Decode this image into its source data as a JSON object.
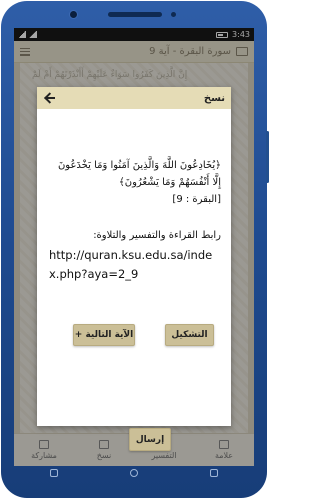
{
  "status_bar": {
    "clock": "3:43"
  },
  "app_bar": {
    "title": "سورة البقرة - آية 9"
  },
  "background_ayah": "إِنَّ الَّذِينَ كَفَرُوا سَوَاءٌ عَلَيْهِمْ أَأَنْذَرْتَهُمْ أَمْ لَمْ",
  "dialog": {
    "title": "نسخ",
    "ayah_text": "﴿يُخَادِعُونَ اللَّهَ وَالَّذِينَ آمَنُوا وَمَا يَخْدَعُونَ إِلَّا أَنْفُسَهُمْ وَمَا يَشْعُرُونَ﴾",
    "reference": "[البقرة : 9]",
    "link_label": "رابط القراءة والتفسير والتلاوة:",
    "url": "http://quran.ksu.edu.sa/index.php?aya=2_9",
    "tashkeel_button": "التشكيل",
    "next_ayah_button": "+ الآية التالية",
    "send_button": "إرسال"
  },
  "tabs": [
    {
      "label": "علامة",
      "icon": "bookmark-icon"
    },
    {
      "label": "التفسير",
      "icon": "comment-icon"
    },
    {
      "label": "نسخ",
      "icon": "copy-icon"
    },
    {
      "label": "مشاركة",
      "icon": "share-icon"
    }
  ]
}
